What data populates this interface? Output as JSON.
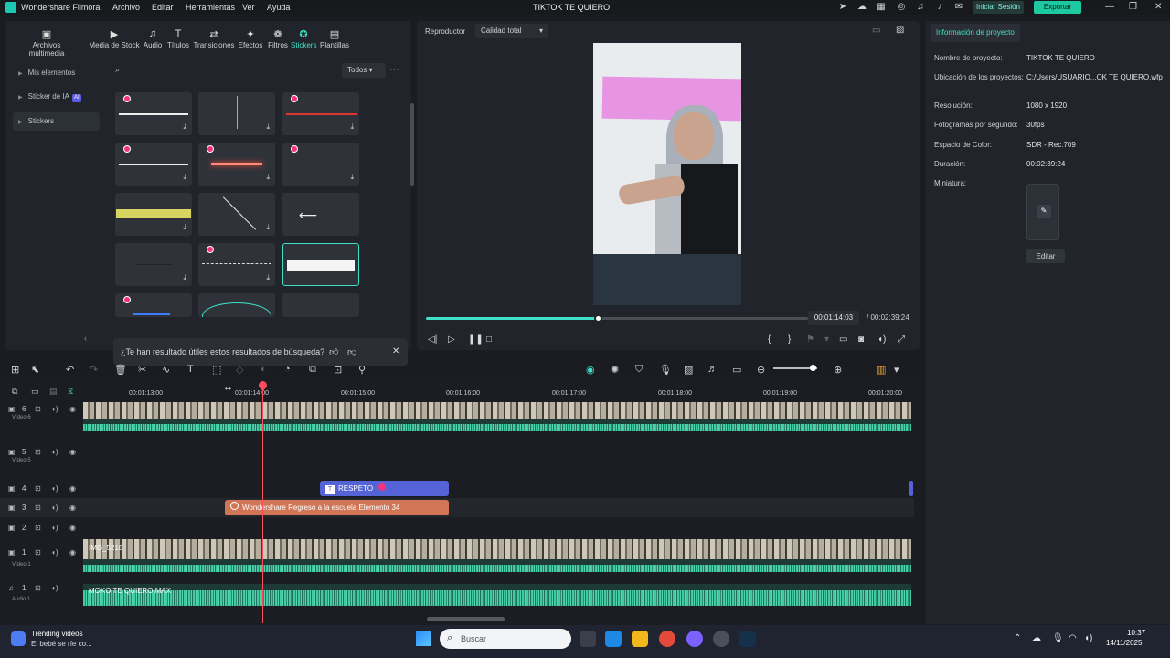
{
  "titlebar": {
    "app_name": "Wondershare Filmora",
    "menu": [
      "Archivo",
      "Editar",
      "Herramientas",
      "Ver",
      "Ayuda"
    ],
    "project_title": "TIKTOK TE QUIERO",
    "login_label": "Iniciar Sesión",
    "export_label": "Exportar"
  },
  "library": {
    "tabs": [
      {
        "label": "Archivos multimedia",
        "icon": "media-icon"
      },
      {
        "label": "Media de Stock",
        "icon": "stock-icon"
      },
      {
        "label": "Audio",
        "icon": "music-icon"
      },
      {
        "label": "Títulos",
        "icon": "text-icon"
      },
      {
        "label": "Transiciones",
        "icon": "transition-icon"
      },
      {
        "label": "Efectos",
        "icon": "effects-icon"
      },
      {
        "label": "Filtros",
        "icon": "filter-icon"
      },
      {
        "label": "Stickers",
        "icon": "sticker-icon",
        "active": true
      },
      {
        "label": "Plantillas",
        "icon": "template-icon"
      }
    ],
    "sidebar": [
      {
        "label": "Mis elementos"
      },
      {
        "label": "Sticker de IA",
        "badge": "AI"
      },
      {
        "label": "Stickers",
        "active": true
      }
    ],
    "filter_label": "Todos",
    "feedback_question": "¿Te han resultado útiles estos resultados de búsqueda?",
    "accent_color": "#3fe0c9"
  },
  "player": {
    "label": "Reproductor",
    "quality": "Calidad total",
    "current_time": "00:01:14:03",
    "total_time": "/ 00:02:39:24",
    "progress": 0.45
  },
  "project_info": {
    "tab_label": "Información de proyecto",
    "fields": [
      {
        "label": "Nombre de proyecto:",
        "value": "TIKTOK TE QUIERO"
      },
      {
        "label": "Ubicación de los proyectos:",
        "value": "C:/Users/USUARIO...OK TE QUIERO.wfp"
      },
      {
        "label": "Resolución:",
        "value": "1080 x 1920"
      },
      {
        "label": "Fotogramas por segundo:",
        "value": "30fps"
      },
      {
        "label": "Espacio de Color:",
        "value": "SDR - Rec.709"
      },
      {
        "label": "Duración:",
        "value": "00:02:39:24"
      },
      {
        "label": "Miniatura:",
        "value": ""
      }
    ],
    "edit_label": "Editar"
  },
  "timeline": {
    "ticks": [
      "00:01:13:00",
      "00:01:14:00",
      "00:01:15:00",
      "00:01:16:00",
      "00:01:17:00",
      "00:01:18:00",
      "00:01:19:00",
      "00:01:20:00"
    ],
    "tracks": [
      {
        "num": "6",
        "name": "Vídeo 6"
      },
      {
        "num": "5",
        "name": "Vídeo 5"
      },
      {
        "num": "4",
        "name": ""
      },
      {
        "num": "3",
        "name": ""
      },
      {
        "num": "2",
        "name": ""
      },
      {
        "num": "1",
        "name": "Vídeo 1"
      },
      {
        "num": "1",
        "name": "Audio 1"
      }
    ],
    "clips": {
      "respeto": "RESPETO",
      "elemento": "Wondershare Regreso a la escuela Elemento 34",
      "video1": "IMG_5218",
      "audio1": "MOKO TE QUIERO MAX"
    }
  },
  "taskbar": {
    "trend_title": "Trending videos",
    "trend_sub": "El bebé se ríe co...",
    "search_placeholder": "Buscar",
    "time": "10:37",
    "date": "14/11/2025"
  }
}
